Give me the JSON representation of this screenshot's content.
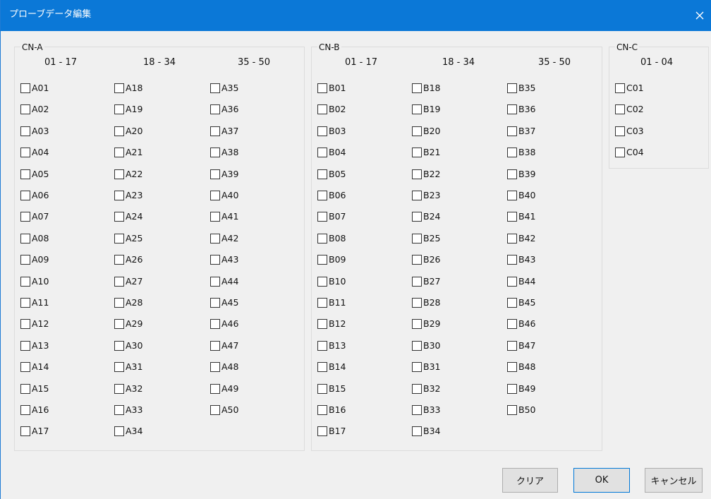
{
  "window": {
    "title": "プローブデータ編集",
    "accent": "#0b78d7"
  },
  "groups": [
    {
      "id": "cn-a",
      "legend": "CN-A",
      "columns": [
        {
          "header": "01 - 17",
          "items": [
            "A01",
            "A02",
            "A03",
            "A04",
            "A05",
            "A06",
            "A07",
            "A08",
            "A09",
            "A10",
            "A11",
            "A12",
            "A13",
            "A14",
            "A15",
            "A16",
            "A17"
          ]
        },
        {
          "header": "18 - 34",
          "items": [
            "A18",
            "A19",
            "A20",
            "A21",
            "A22",
            "A23",
            "A24",
            "A25",
            "A26",
            "A27",
            "A28",
            "A29",
            "A30",
            "A31",
            "A32",
            "A33",
            "A34"
          ]
        },
        {
          "header": "35 - 50",
          "items": [
            "A35",
            "A36",
            "A37",
            "A38",
            "A39",
            "A40",
            "A41",
            "A42",
            "A43",
            "A44",
            "A45",
            "A46",
            "A47",
            "A48",
            "A49",
            "A50"
          ]
        }
      ]
    },
    {
      "id": "cn-b",
      "legend": "CN-B",
      "columns": [
        {
          "header": "01 - 17",
          "items": [
            "B01",
            "B02",
            "B03",
            "B04",
            "B05",
            "B06",
            "B07",
            "B08",
            "B09",
            "B10",
            "B11",
            "B12",
            "B13",
            "B14",
            "B15",
            "B16",
            "B17"
          ]
        },
        {
          "header": "18 - 34",
          "items": [
            "B18",
            "B19",
            "B20",
            "B21",
            "B22",
            "B23",
            "B24",
            "B25",
            "B26",
            "B27",
            "B28",
            "B29",
            "B30",
            "B31",
            "B32",
            "B33",
            "B34"
          ]
        },
        {
          "header": "35 - 50",
          "items": [
            "B35",
            "B36",
            "B37",
            "B38",
            "B39",
            "B40",
            "B41",
            "B42",
            "B43",
            "B44",
            "B45",
            "B46",
            "B47",
            "B48",
            "B49",
            "B50"
          ]
        }
      ]
    },
    {
      "id": "cn-c",
      "legend": "CN-C",
      "columns": [
        {
          "header": "01 - 04",
          "items": [
            "C01",
            "C02",
            "C03",
            "C04"
          ]
        }
      ]
    }
  ],
  "buttons": {
    "clear": "クリア",
    "ok": "OK",
    "cancel": "キャンセル"
  }
}
